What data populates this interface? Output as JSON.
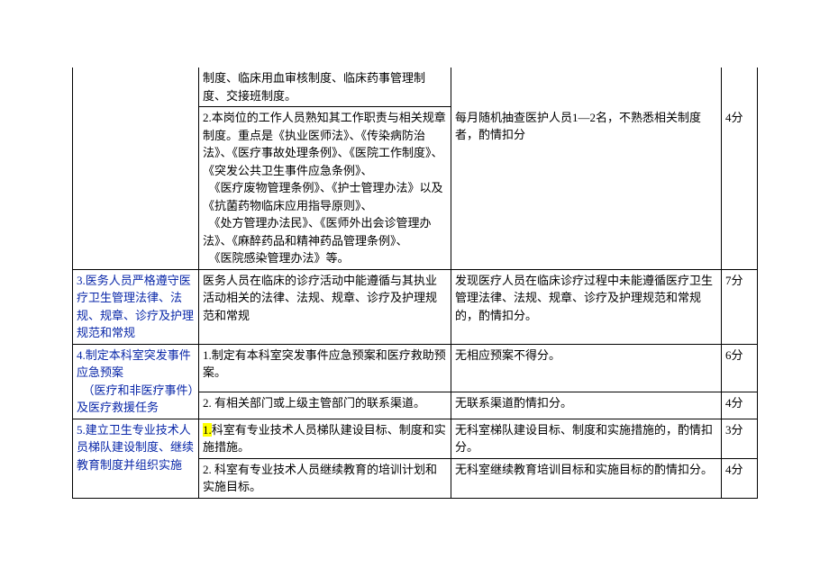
{
  "rows": [
    {
      "c1": "",
      "c2": "制度、临床用血审核制度、临床药事管理制度、交接班制度。",
      "c3": "",
      "c4": ""
    },
    {
      "c1": "",
      "c2": "2.本岗位的工作人员熟知其工作职责与相关规章制度。重点是《执业医师法》、《传染病防治法》、《医疗事故处理条例》、《医院工作制度》、《突发公共卫生事件应急条例》、\n　《医疗废物管理条例》、《护士管理办法》以及《抗菌药物临床应用指导原则》、\n　《处方管理办法民》、《医师外出会诊管理办法》、《麻醉药品和精神药品管理条例》、\n　《医院感染管理办法》等。",
      "c3": "每月随机抽查医护人员1—2名，不熟悉相关制度者，酌情扣分",
      "c4": "4分"
    },
    {
      "c1": "3.医务人员严格遵守医疗卫生管理法律、法规、规章、诊疗及护理规范和常规",
      "c2": "医务人员在临床的诊疗活动中能遵循与其执业活动相关的法律、法规、规章、诊疗及护理规范和常规",
      "c3": "发现医疗人员在临床诊疗过程中未能遵循医疗卫生管理法律、法规、规章、诊疗及护理规范和常规的，酌情扣分。",
      "c4": "7分"
    },
    {
      "c1_a": "4.制定本科室突发事件应急预案\n　（医疗和非医疗事件）及医疗救援任务",
      "c2_a": "1.制定有本科室突发事件应急预案和医疗救助预案。",
      "c3_a": "无相应预案不得分。",
      "c4_a": "6分",
      "c2_b": "2. 有相关部门或上级主管部门的联系渠道。",
      "c3_b": "无联系渠道酌情扣分。",
      "c4_b": "4分"
    },
    {
      "c1_a": "5.建立卫生专业技术人员梯队建设制度、继续教育制度并组织实施",
      "c2_a_prefix": "1.",
      "c2_a": "科室有专业技术人员梯队建设目标、制度和实施措施。",
      "c3_a": "无科室梯队建设目标、制度和实施措施的，酌情扣分。",
      "c4_a": "3分",
      "c2_b": "2. 科室有专业技术人员继续教育的培训计划和实施目标。",
      "c3_b": "无科室继续教育培训目标和实施目标的酌情扣分。",
      "c4_b": "4分"
    }
  ]
}
